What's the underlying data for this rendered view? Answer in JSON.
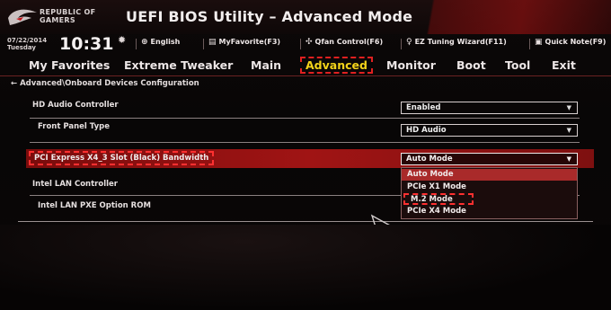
{
  "header": {
    "brand_line1": "REPUBLIC OF",
    "brand_line2": "GAMERS",
    "title": "UEFI BIOS Utility – Advanced Mode"
  },
  "status": {
    "date": "07/22/2014",
    "day": "Tuesday",
    "time": "10:31",
    "items": [
      {
        "icon": "globe-icon",
        "label": "English"
      },
      {
        "icon": "favorite-icon",
        "label": "MyFavorite(F3)"
      },
      {
        "icon": "fan-icon",
        "label": "Qfan Control(F6)"
      },
      {
        "icon": "bulb-icon",
        "label": "EZ Tuning Wizard(F11)"
      },
      {
        "icon": "note-icon",
        "label": "Quick Note(F9)"
      }
    ]
  },
  "menu": {
    "items": [
      "My Favorites",
      "Extreme Tweaker",
      "Main",
      "Advanced",
      "Monitor",
      "Boot",
      "Tool",
      "Exit"
    ],
    "active": "Advanced"
  },
  "breadcrumb": "Advanced\\Onboard Devices Configuration",
  "settings": {
    "hd_audio": {
      "label": "HD Audio Controller",
      "value": "Enabled"
    },
    "front_panel": {
      "label": "Front Panel Type",
      "value": "HD Audio"
    },
    "pcie_bw": {
      "label": "PCI Express X4_3 Slot (Black) Bandwidth",
      "value": "Auto Mode"
    },
    "intel_lan": {
      "label": "Intel LAN Controller"
    },
    "intel_pxe": {
      "label": "Intel LAN PXE Option ROM"
    }
  },
  "dropdown": {
    "options": [
      "Auto Mode",
      "PCIe X1 Mode",
      "M.2 Mode",
      "PCIe X4 Mode"
    ],
    "highlighted": "Auto Mode",
    "boxed": "M.2 Mode"
  },
  "colors": {
    "accent_red": "#a01414",
    "active_tab": "#f2d21a",
    "highlight_dash": "#ff3030"
  }
}
